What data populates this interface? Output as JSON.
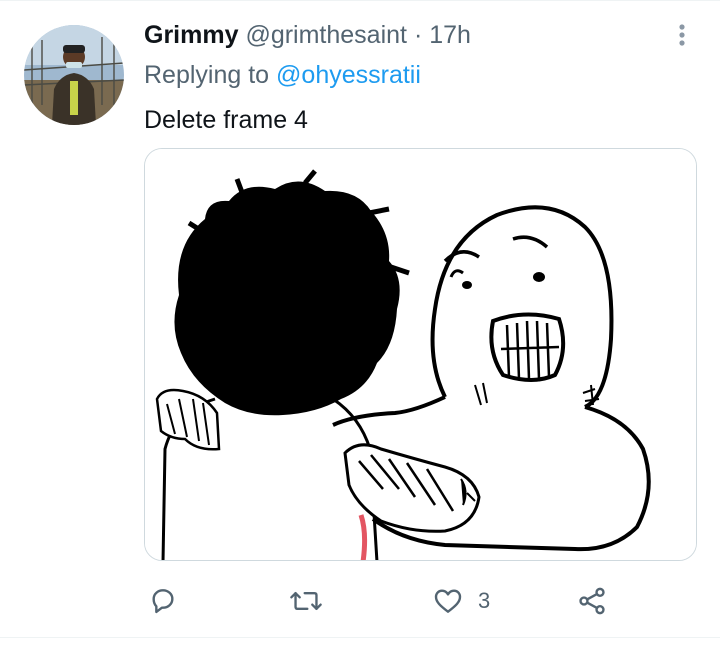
{
  "tweet": {
    "display_name": "Grimmy",
    "handle": "@grimthesaint",
    "separator": "·",
    "time": "17h",
    "replying_prefix": "Replying to",
    "replying_to": "@ohyessratii",
    "text": "Delete frame 4"
  },
  "actions": {
    "reply_icon": "reply-icon",
    "retweet_icon": "retweet-icon",
    "like_icon": "heart-icon",
    "like_count": "3",
    "share_icon": "share-icon"
  },
  "colors": {
    "accent": "#1d9bf0",
    "secondary_text": "#536471",
    "primary_text": "#0f1419"
  }
}
